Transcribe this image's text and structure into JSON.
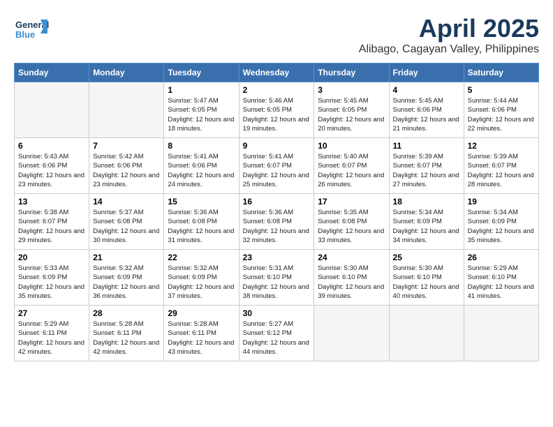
{
  "header": {
    "logo_text_general": "General",
    "logo_text_blue": "Blue",
    "month_year": "April 2025",
    "location": "Alibago, Cagayan Valley, Philippines"
  },
  "weekdays": [
    "Sunday",
    "Monday",
    "Tuesday",
    "Wednesday",
    "Thursday",
    "Friday",
    "Saturday"
  ],
  "weeks": [
    [
      {
        "day": "",
        "info": ""
      },
      {
        "day": "",
        "info": ""
      },
      {
        "day": "1",
        "info": "Sunrise: 5:47 AM\nSunset: 6:05 PM\nDaylight: 12 hours and 18 minutes."
      },
      {
        "day": "2",
        "info": "Sunrise: 5:46 AM\nSunset: 6:05 PM\nDaylight: 12 hours and 19 minutes."
      },
      {
        "day": "3",
        "info": "Sunrise: 5:45 AM\nSunset: 6:05 PM\nDaylight: 12 hours and 20 minutes."
      },
      {
        "day": "4",
        "info": "Sunrise: 5:45 AM\nSunset: 6:06 PM\nDaylight: 12 hours and 21 minutes."
      },
      {
        "day": "5",
        "info": "Sunrise: 5:44 AM\nSunset: 6:06 PM\nDaylight: 12 hours and 22 minutes."
      }
    ],
    [
      {
        "day": "6",
        "info": "Sunrise: 5:43 AM\nSunset: 6:06 PM\nDaylight: 12 hours and 23 minutes."
      },
      {
        "day": "7",
        "info": "Sunrise: 5:42 AM\nSunset: 6:06 PM\nDaylight: 12 hours and 23 minutes."
      },
      {
        "day": "8",
        "info": "Sunrise: 5:41 AM\nSunset: 6:06 PM\nDaylight: 12 hours and 24 minutes."
      },
      {
        "day": "9",
        "info": "Sunrise: 5:41 AM\nSunset: 6:07 PM\nDaylight: 12 hours and 25 minutes."
      },
      {
        "day": "10",
        "info": "Sunrise: 5:40 AM\nSunset: 6:07 PM\nDaylight: 12 hours and 26 minutes."
      },
      {
        "day": "11",
        "info": "Sunrise: 5:39 AM\nSunset: 6:07 PM\nDaylight: 12 hours and 27 minutes."
      },
      {
        "day": "12",
        "info": "Sunrise: 5:39 AM\nSunset: 6:07 PM\nDaylight: 12 hours and 28 minutes."
      }
    ],
    [
      {
        "day": "13",
        "info": "Sunrise: 5:38 AM\nSunset: 6:07 PM\nDaylight: 12 hours and 29 minutes."
      },
      {
        "day": "14",
        "info": "Sunrise: 5:37 AM\nSunset: 6:08 PM\nDaylight: 12 hours and 30 minutes."
      },
      {
        "day": "15",
        "info": "Sunrise: 5:36 AM\nSunset: 6:08 PM\nDaylight: 12 hours and 31 minutes."
      },
      {
        "day": "16",
        "info": "Sunrise: 5:36 AM\nSunset: 6:08 PM\nDaylight: 12 hours and 32 minutes."
      },
      {
        "day": "17",
        "info": "Sunrise: 5:35 AM\nSunset: 6:08 PM\nDaylight: 12 hours and 33 minutes."
      },
      {
        "day": "18",
        "info": "Sunrise: 5:34 AM\nSunset: 6:09 PM\nDaylight: 12 hours and 34 minutes."
      },
      {
        "day": "19",
        "info": "Sunrise: 5:34 AM\nSunset: 6:09 PM\nDaylight: 12 hours and 35 minutes."
      }
    ],
    [
      {
        "day": "20",
        "info": "Sunrise: 5:33 AM\nSunset: 6:09 PM\nDaylight: 12 hours and 35 minutes."
      },
      {
        "day": "21",
        "info": "Sunrise: 5:32 AM\nSunset: 6:09 PM\nDaylight: 12 hours and 36 minutes."
      },
      {
        "day": "22",
        "info": "Sunrise: 5:32 AM\nSunset: 6:09 PM\nDaylight: 12 hours and 37 minutes."
      },
      {
        "day": "23",
        "info": "Sunrise: 5:31 AM\nSunset: 6:10 PM\nDaylight: 12 hours and 38 minutes."
      },
      {
        "day": "24",
        "info": "Sunrise: 5:30 AM\nSunset: 6:10 PM\nDaylight: 12 hours and 39 minutes."
      },
      {
        "day": "25",
        "info": "Sunrise: 5:30 AM\nSunset: 6:10 PM\nDaylight: 12 hours and 40 minutes."
      },
      {
        "day": "26",
        "info": "Sunrise: 5:29 AM\nSunset: 6:10 PM\nDaylight: 12 hours and 41 minutes."
      }
    ],
    [
      {
        "day": "27",
        "info": "Sunrise: 5:29 AM\nSunset: 6:11 PM\nDaylight: 12 hours and 42 minutes."
      },
      {
        "day": "28",
        "info": "Sunrise: 5:28 AM\nSunset: 6:11 PM\nDaylight: 12 hours and 42 minutes."
      },
      {
        "day": "29",
        "info": "Sunrise: 5:28 AM\nSunset: 6:11 PM\nDaylight: 12 hours and 43 minutes."
      },
      {
        "day": "30",
        "info": "Sunrise: 5:27 AM\nSunset: 6:12 PM\nDaylight: 12 hours and 44 minutes."
      },
      {
        "day": "",
        "info": ""
      },
      {
        "day": "",
        "info": ""
      },
      {
        "day": "",
        "info": ""
      }
    ]
  ]
}
